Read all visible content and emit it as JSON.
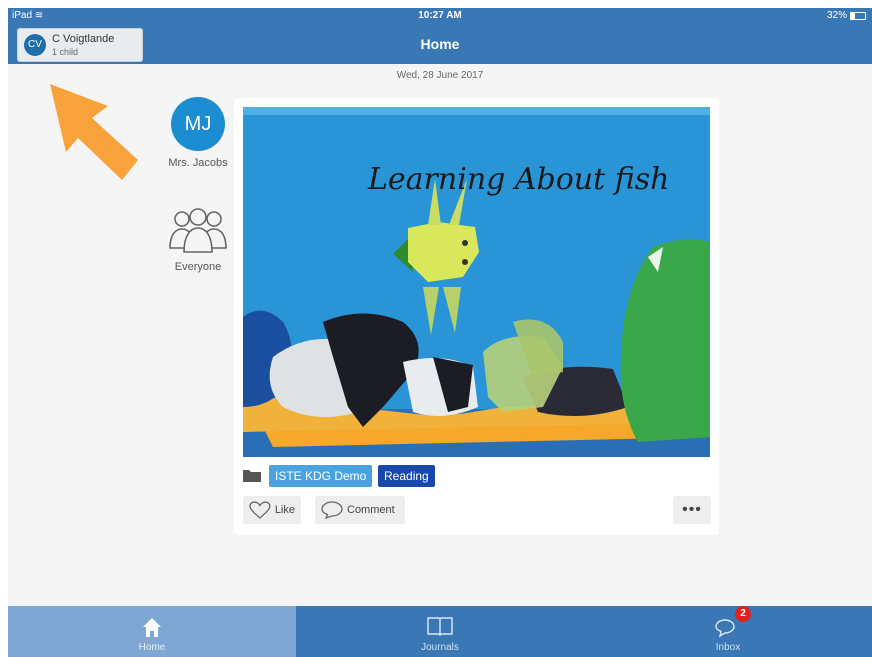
{
  "status_bar": {
    "device": "iPad",
    "time": "10:27 AM",
    "battery": "32%",
    "battery_level": 0.32
  },
  "nav": {
    "title": "Home",
    "account": {
      "initials": "CV",
      "name": "C Voigtlande",
      "subtitle": "1 child"
    }
  },
  "feed": {
    "date": "Wed, 28 June 2017",
    "post": {
      "author_initials": "MJ",
      "author_name": "Mrs. Jacobs",
      "audience": "Everyone",
      "image_text": "Learning About fish",
      "tags": [
        "ISTE KDG Demo",
        "Reading"
      ],
      "like_label": "Like",
      "comment_label": "Comment",
      "more_label": "•••"
    }
  },
  "tabs": [
    {
      "label": "Home",
      "icon": "home-icon",
      "active": true
    },
    {
      "label": "Journals",
      "icon": "book-icon",
      "active": false
    },
    {
      "label": "Inbox",
      "icon": "chat-bubbles-icon",
      "active": false,
      "badge": "2"
    }
  ],
  "colors": {
    "brand_blue": "#3a78b5",
    "tab_active": "#7fa7d3",
    "avatar_blue": "#1b8dd0",
    "tag_light": "#4aa3df",
    "tag_dark": "#1949a8",
    "annotation_arrow": "#f7a23b",
    "badge_red": "#e02020"
  }
}
